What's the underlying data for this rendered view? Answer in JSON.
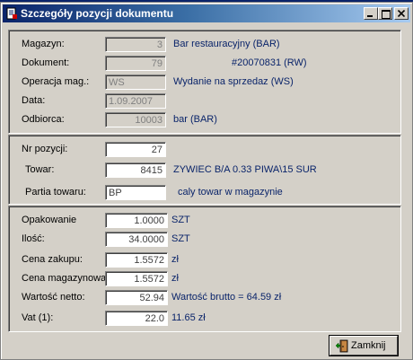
{
  "window": {
    "title": "Szczegóły pozycji dokumentu"
  },
  "header_section": {
    "magazyn_label": "Magazyn:",
    "magazyn_value": "3",
    "magazyn_name": "Bar restauracyjny (BAR)",
    "dokument_label": "Dokument:",
    "dokument_value": "79",
    "dokument_name": "#20070831 (RW)",
    "operacja_label": "Operacja mag.:",
    "operacja_value": "WS",
    "operacja_name": "Wydanie na sprzedaz (WS)",
    "data_label": "Data:",
    "data_value": "1.09.2007",
    "odbiorca_label": "Odbiorca:",
    "odbiorca_value": "10003",
    "odbiorca_name": "bar (BAR)"
  },
  "item_section": {
    "nr_label": "Nr pozycji:",
    "nr_value": "27",
    "towar_label": "Towar:",
    "towar_value": "8415",
    "towar_name": "ZYWIEC B/A 0.33 PIWA\\15    SUR",
    "partia_label": "Partia towaru:",
    "partia_value": "BP",
    "partia_desc": "caly towar w magazynie"
  },
  "quantity_section": {
    "opakowanie_label": "Opakowanie",
    "opakowanie_value": "1.0000",
    "opakowanie_unit": "SZT",
    "ilosc_label": "Ilość:",
    "ilosc_value": "34.0000",
    "ilosc_unit": "SZT",
    "cena_zakupu_label": "Cena zakupu:",
    "cena_zakupu_value": "1.5572",
    "cena_zakupu_unit": "zł",
    "cena_mag_label": "Cena magazynowa:",
    "cena_mag_value": "1.5572",
    "cena_mag_unit": "zł",
    "wartosc_label": "Wartość netto:",
    "wartosc_value": "52.94",
    "wartosc_brutto": "Wartość brutto = 64.59 zł",
    "vat_label": "Vat (1):",
    "vat_value": "22.0",
    "vat_amount": "11.65 zł"
  },
  "buttons": {
    "close_label": "Zamknij"
  },
  "colors": {
    "titlebar_start": "#0a246a",
    "titlebar_end": "#a6caf0",
    "face": "#d4d0c8",
    "value_text": "#0a246a"
  }
}
